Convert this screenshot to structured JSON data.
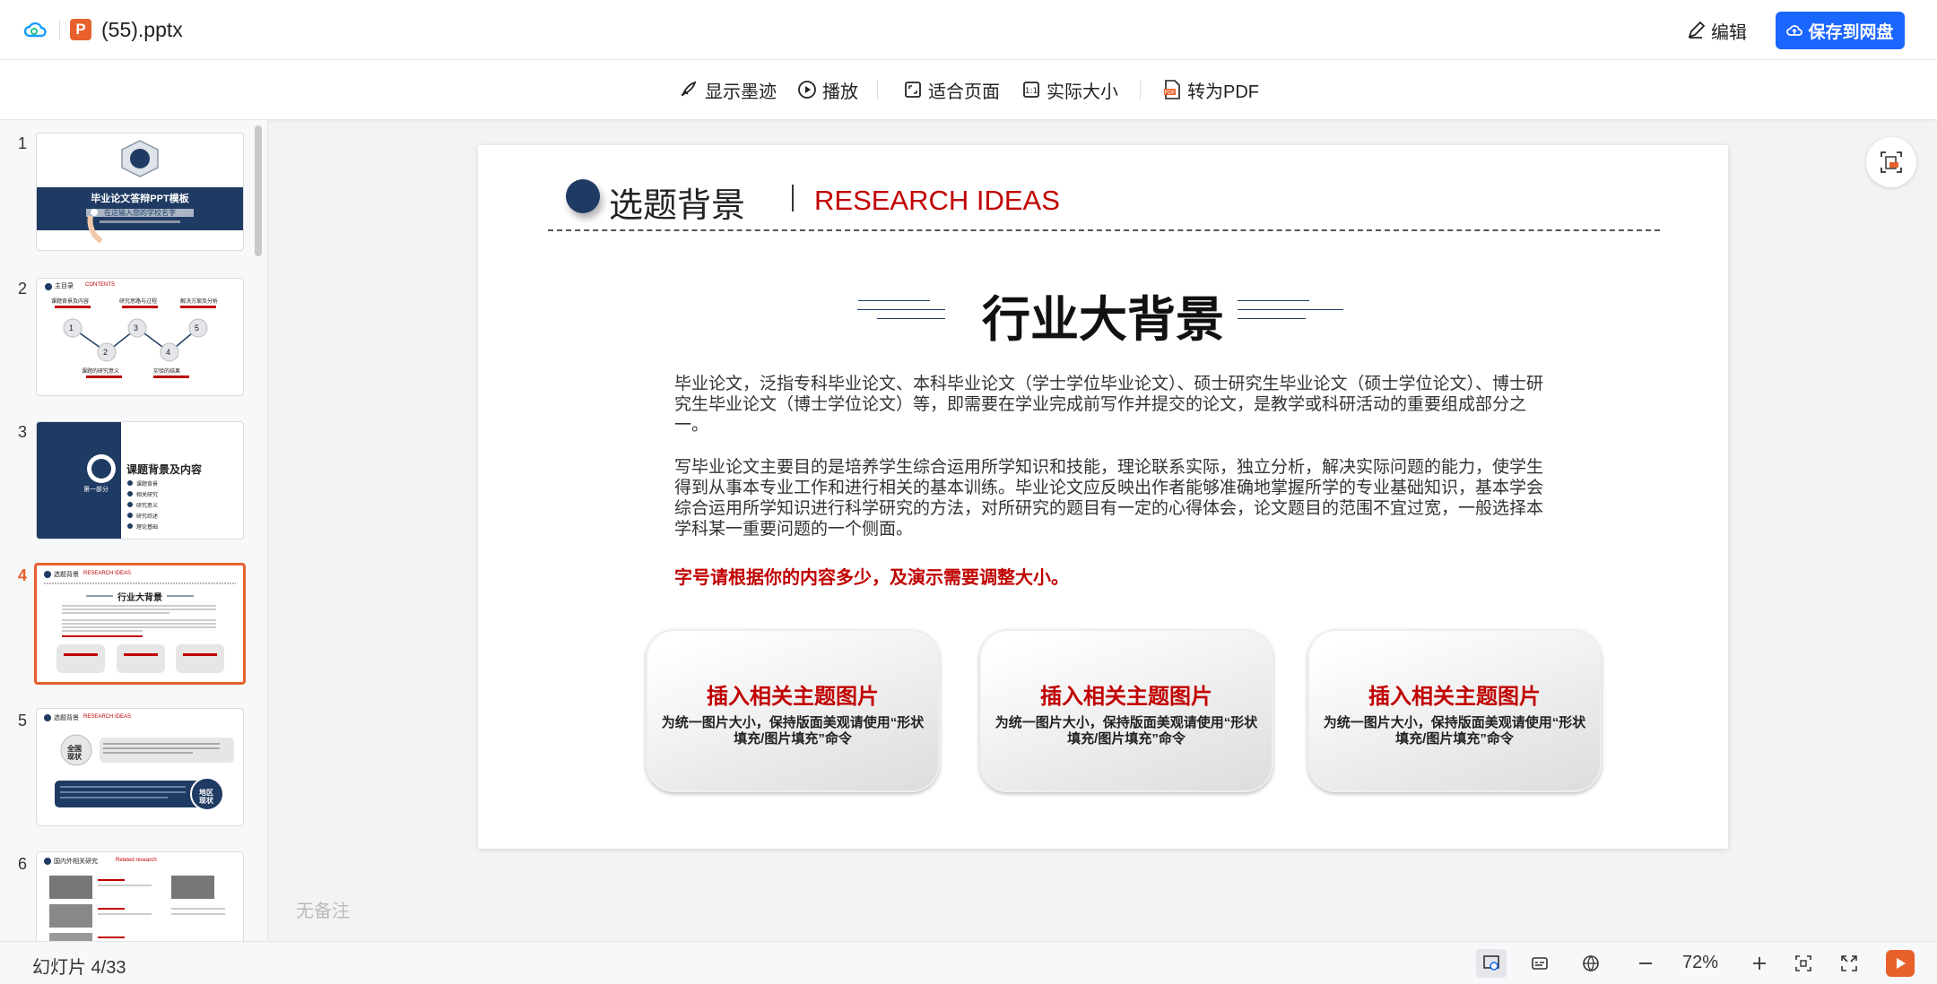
{
  "header": {
    "filename": "(55).pptx",
    "ppt_icon_letter": "P",
    "edit_label": "编辑",
    "save_label": "保存到网盘"
  },
  "toolbar": {
    "show_ink": "显示墨迹",
    "play": "播放",
    "fit_page": "适合页面",
    "actual_size": "实际大小",
    "to_pdf": "转为PDF"
  },
  "thumbnails": [
    {
      "num": "1",
      "title": "毕业论文答辩PPT模板",
      "subtitle": "在这输入您的学校名字"
    },
    {
      "num": "2",
      "header": "主目录",
      "header_en": "CONTENTS",
      "items": [
        "1",
        "2",
        "3",
        "4",
        "5"
      ],
      "labels": [
        "课题背景及内容",
        "研究思路与过程",
        "解决方案及分析",
        "课题的研究意义",
        "实验的结果"
      ]
    },
    {
      "num": "3",
      "title": "课题背景及内容",
      "part": "第一部分",
      "items": [
        "课题背景",
        "相关研究",
        "研究意义",
        "研究综述",
        "理论基础"
      ]
    },
    {
      "num": "4",
      "header": "选题背景",
      "header_en": "RESEARCH IDEAS",
      "title": "行业大背景"
    },
    {
      "num": "5",
      "header": "选题背景",
      "header_en": "RESEARCH IDEAS",
      "label1": "全国现状",
      "label2": "地区现状"
    },
    {
      "num": "6",
      "header": "国内外相关研究",
      "header_en": "Related research"
    }
  ],
  "slide": {
    "head_cn": "选题背景",
    "head_en": "RESEARCH IDEAS",
    "title": "行业大背景",
    "para1": "毕业论文，泛指专科毕业论文、本科毕业论文（学士学位毕业论文）、硕士研究生毕业论文（硕士学位论文）、博士研究生毕业论文（博士学位论文）等，即需要在学业完成前写作并提交的论文，是教学或科研活动的重要组成部分之一。",
    "para2": "写毕业论文主要目的是培养学生综合运用所学知识和技能，理论联系实际，独立分析，解决实际问题的能力，使学生得到从事本专业工作和进行相关的基本训练。毕业论文应反映出作者能够准确地掌握所学的专业基础知识，基本学会综合运用所学知识进行科学研究的方法，对所研究的题目有一定的心得体会，论文题目的范围不宜过宽，一般选择本学科某一重要问题的一个侧面。",
    "red_note": "字号请根据你的内容多少，及演示需要调整大小。",
    "cards": [
      {
        "title": "插入相关主题图片",
        "body": "为统一图片大小，保持版面美观请使用“形状填充/图片填充”命令"
      },
      {
        "title": "插入相关主题图片",
        "body": "为统一图片大小，保持版面美观请使用“形状填充/图片填充”命令"
      },
      {
        "title": "插入相关主题图片",
        "body": "为统一图片大小，保持版面美观请使用“形状填充/图片填充”命令"
      }
    ]
  },
  "notes_placeholder": "无备注",
  "status": {
    "slide_label": "幻灯片 4/33",
    "zoom": "72%"
  },
  "colors": {
    "accent_blue": "#1a66ff",
    "ppt_orange": "#e8602c",
    "slide_red": "#c00000",
    "slide_navy": "#1f3b63"
  }
}
